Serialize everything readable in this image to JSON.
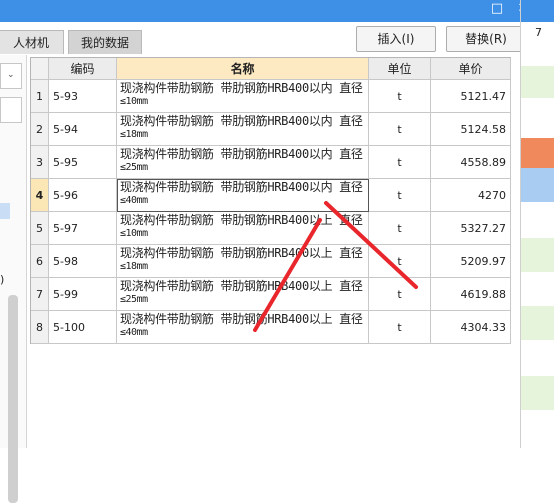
{
  "window": {
    "title_controls": [
      "□",
      "✕"
    ]
  },
  "tabs": [
    {
      "label": "人材机"
    },
    {
      "label": "我的数据"
    }
  ],
  "toolbar": {
    "insert_label": "插入(I)",
    "replace_label": "替换(R)"
  },
  "table": {
    "headers": {
      "code": "编码",
      "name": "名称",
      "unit": "单位",
      "price": "单价"
    },
    "rows": [
      {
        "index": "1",
        "code": "5-93",
        "name_line1": "现浇构件带肋钢筋 带肋钢筋HRB400以内 直径",
        "name_line2": "≤10mm",
        "unit": "t",
        "price": "5121.47"
      },
      {
        "index": "2",
        "code": "5-94",
        "name_line1": "现浇构件带肋钢筋 带肋钢筋HRB400以内 直径",
        "name_line2": "≤18mm",
        "unit": "t",
        "price": "5124.58"
      },
      {
        "index": "3",
        "code": "5-95",
        "name_line1": "现浇构件带肋钢筋 带肋钢筋HRB400以内 直径",
        "name_line2": "≤25mm",
        "unit": "t",
        "price": "4558.89"
      },
      {
        "index": "4",
        "code": "5-96",
        "name_line1": "现浇构件带肋钢筋 带肋钢筋HRB400以内 直径",
        "name_line2": "≤40mm",
        "unit": "t",
        "price": "4270",
        "selected": true
      },
      {
        "index": "5",
        "code": "5-97",
        "name_line1": "现浇构件带肋钢筋 带肋钢筋HRB400以上 直径",
        "name_line2": "≤10mm",
        "unit": "t",
        "price": "5327.27"
      },
      {
        "index": "6",
        "code": "5-98",
        "name_line1": "现浇构件带肋钢筋 带肋钢筋HRB400以上 直径",
        "name_line2": "≤18mm",
        "unit": "t",
        "price": "5209.97"
      },
      {
        "index": "7",
        "code": "5-99",
        "name_line1": "现浇构件带肋钢筋 带肋钢筋HRB400以上 直径",
        "name_line2": "≤25mm",
        "unit": "t",
        "price": "4619.88"
      },
      {
        "index": "8",
        "code": "5-100",
        "name_line1": "现浇构件带肋钢筋 带肋钢筋HRB400以上 直径",
        "name_line2": "≤40mm",
        "unit": "t",
        "price": "4304.33"
      }
    ]
  },
  "right_panel": {
    "value_label": "7"
  },
  "left_panel": {
    "edge_label": ")"
  },
  "colors": {
    "title_bar": "#3e8fe6",
    "header_name_bg": "#fde9c2",
    "annotation_red": "#e8262b",
    "orange_strip": "#f08a5d",
    "blue_strip": "#a9cdf2",
    "green_strip": "#e6f4dc"
  }
}
